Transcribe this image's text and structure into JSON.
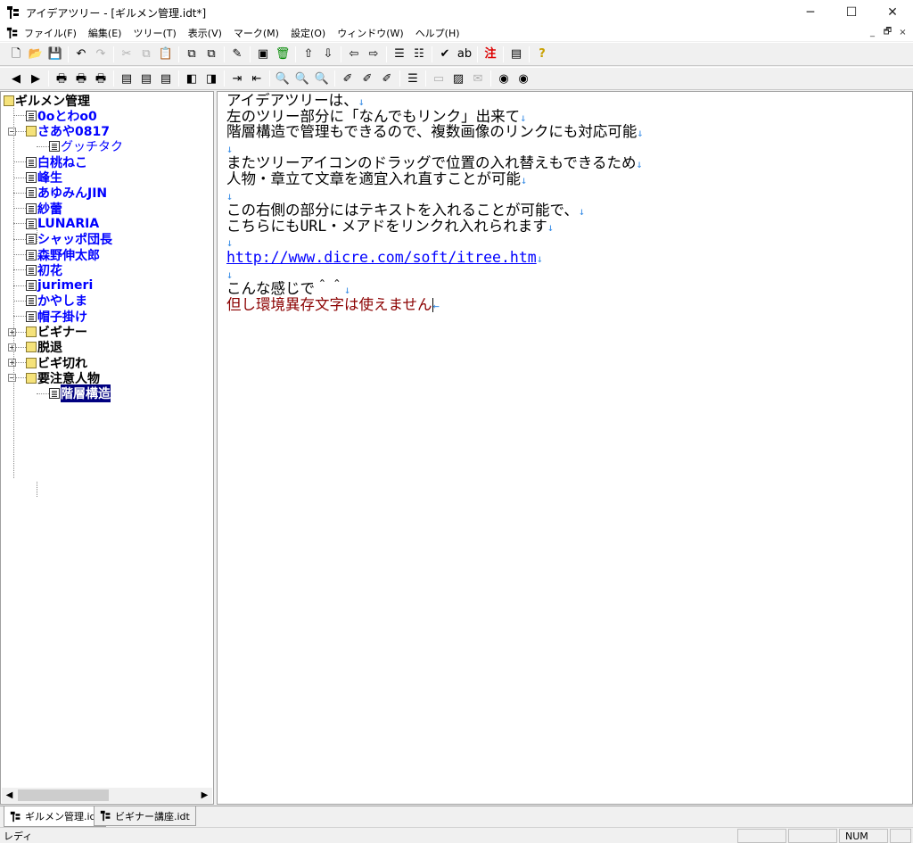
{
  "window": {
    "title": "アイデアツリー - [ギルメン管理.idt*]",
    "minimize": "─",
    "maximize": "☐",
    "close": "✕"
  },
  "menu": {
    "items": [
      "ファイル(F)",
      "編集(E)",
      "ツリー(T)",
      "表示(V)",
      "マーク(M)",
      "設定(O)",
      "ウィンドウ(W)",
      "ヘルプ(H)"
    ],
    "mdi_min": "_",
    "mdi_restore": "🗗",
    "mdi_close": "×"
  },
  "toolbar1": [
    {
      "icon": "new-file-icon",
      "glyph": "🗋"
    },
    {
      "icon": "open-folder-icon",
      "glyph": "📂"
    },
    {
      "icon": "save-icon",
      "glyph": "💾"
    },
    {
      "sep": true
    },
    {
      "icon": "undo-icon",
      "glyph": "↶"
    },
    {
      "icon": "redo-icon",
      "glyph": "↷",
      "disabled": true
    },
    {
      "sep": true
    },
    {
      "icon": "cut-icon",
      "glyph": "✂",
      "disabled": true
    },
    {
      "icon": "copy-icon",
      "glyph": "⧉",
      "disabled": true
    },
    {
      "icon": "paste-icon",
      "glyph": "📋"
    },
    {
      "sep": true
    },
    {
      "icon": "copy-node-icon",
      "glyph": "⧉"
    },
    {
      "icon": "paste-node-icon",
      "glyph": "⧉"
    },
    {
      "sep": true
    },
    {
      "icon": "edit-node-icon",
      "glyph": "✎"
    },
    {
      "sep": true
    },
    {
      "icon": "insert-node-icon",
      "glyph": "▣"
    },
    {
      "icon": "delete-node-icon",
      "glyph": "🗑"
    },
    {
      "sep": true
    },
    {
      "icon": "move-up-icon",
      "glyph": "⇧"
    },
    {
      "icon": "move-down-icon",
      "glyph": "⇩"
    },
    {
      "sep": true
    },
    {
      "icon": "move-left-icon",
      "glyph": "⇦"
    },
    {
      "icon": "move-right-icon",
      "glyph": "⇨"
    },
    {
      "sep": true
    },
    {
      "icon": "tree-level-icon",
      "glyph": "☰"
    },
    {
      "icon": "tree-expand-icon",
      "glyph": "☷"
    },
    {
      "sep": true
    },
    {
      "icon": "check-icon",
      "glyph": "✔"
    },
    {
      "icon": "strikethrough-icon",
      "glyph": "ab"
    },
    {
      "sep": true
    },
    {
      "icon": "note-mark-icon",
      "glyph": "注"
    },
    {
      "sep": true
    },
    {
      "icon": "window-icon",
      "glyph": "▤"
    },
    {
      "sep": true
    },
    {
      "icon": "help-icon",
      "glyph": "?"
    }
  ],
  "toolbar2": [
    {
      "icon": "back-icon",
      "glyph": "◀"
    },
    {
      "icon": "forward-icon",
      "glyph": "▶"
    },
    {
      "sep": true
    },
    {
      "icon": "print-icon",
      "glyph": "🖶"
    },
    {
      "icon": "print-preview-icon",
      "glyph": "🖶"
    },
    {
      "icon": "print-setup-icon",
      "glyph": "🖶"
    },
    {
      "sep": true
    },
    {
      "icon": "view-tree-icon",
      "glyph": "▤"
    },
    {
      "icon": "view-text-icon",
      "glyph": "▤"
    },
    {
      "icon": "view-split-icon",
      "glyph": "▤"
    },
    {
      "sep": true
    },
    {
      "icon": "layout-horizontal-icon",
      "glyph": "◧"
    },
    {
      "icon": "layout-vertical-icon",
      "glyph": "◨"
    },
    {
      "sep": true
    },
    {
      "icon": "import-icon",
      "glyph": "⇥"
    },
    {
      "icon": "export-icon",
      "glyph": "⇤"
    },
    {
      "sep": true
    },
    {
      "icon": "search-icon",
      "glyph": "🔍"
    },
    {
      "icon": "search-next-icon",
      "glyph": "🔍",
      "disabled": true
    },
    {
      "icon": "search-prev-icon",
      "glyph": "🔍",
      "disabled": true
    },
    {
      "sep": true
    },
    {
      "icon": "marker-a-icon",
      "glyph": "✐"
    },
    {
      "icon": "marker-b-icon",
      "glyph": "✐"
    },
    {
      "icon": "marker-c-icon",
      "glyph": "✐"
    },
    {
      "sep": true
    },
    {
      "icon": "tree-list-icon",
      "glyph": "☰"
    },
    {
      "sep": true
    },
    {
      "icon": "camera-icon",
      "glyph": "▭",
      "disabled": true
    },
    {
      "icon": "image-icon",
      "glyph": "▨"
    },
    {
      "icon": "mail-icon",
      "glyph": "✉",
      "disabled": true
    },
    {
      "sep": true
    },
    {
      "icon": "globe-icon",
      "glyph": "◉"
    },
    {
      "icon": "web-link-icon",
      "glyph": "◉"
    }
  ],
  "tree": {
    "nodes": [
      {
        "label": "ギルメン管理",
        "kind": "root-folder",
        "color": "black"
      },
      {
        "label": "0oとわo0",
        "kind": "doc"
      },
      {
        "label": "さあや0817",
        "kind": "folder",
        "expander": "−"
      },
      {
        "label": "グッチタク",
        "kind": "doc",
        "indent": 2,
        "plain": true
      },
      {
        "label": "白桃ねこ",
        "kind": "doc"
      },
      {
        "label": "峰生",
        "kind": "doc"
      },
      {
        "label": "あゆみんJIN",
        "kind": "doc"
      },
      {
        "label": "紗蕾",
        "kind": "doc"
      },
      {
        "label": "LUNARIA",
        "kind": "doc"
      },
      {
        "label": "シャッポ団長",
        "kind": "doc"
      },
      {
        "label": "森野伸太郎",
        "kind": "doc"
      },
      {
        "label": "初花",
        "kind": "doc"
      },
      {
        "label": "jurimeri",
        "kind": "doc"
      },
      {
        "label": "かやしま",
        "kind": "doc"
      },
      {
        "label": "帽子掛け",
        "kind": "doc"
      },
      {
        "label": "ビギナー",
        "kind": "folder",
        "color": "black",
        "expander": "+"
      },
      {
        "label": "脱退",
        "kind": "folder",
        "color": "black",
        "expander": "+"
      },
      {
        "label": "ビギ切れ",
        "kind": "folder",
        "color": "black",
        "expander": "+"
      },
      {
        "label": "要注意人物",
        "kind": "folder",
        "color": "black",
        "expander": "−"
      },
      {
        "label": "階層構造",
        "kind": "doc",
        "indent": 2,
        "selected": true
      }
    ]
  },
  "editor": {
    "lines": [
      {
        "text": "アイデアツリーは、",
        "ret": "↓"
      },
      {
        "text": "左のツリー部分に「なんでもリンク」出来て",
        "ret": "↓"
      },
      {
        "text": "階層構造で管理もできるので、複数画像のリンクにも対応可能",
        "ret": "↓"
      },
      {
        "text": "",
        "ret": "↓"
      },
      {
        "text": "またツリーアイコンのドラッグで位置の入れ替えもできるため",
        "ret": "↓"
      },
      {
        "text": "人物・章立て文章を適宜入れ直すことが可能",
        "ret": "↓"
      },
      {
        "text": "",
        "ret": "↓"
      },
      {
        "text": "この右側の部分にはテキストを入れることが可能で、",
        "ret": "↓"
      },
      {
        "text": "こちらにもURL・メアドをリンクれ入れられます",
        "ret": "↓"
      },
      {
        "text": "",
        "ret": "↓"
      },
      {
        "text": "http://www.dicre.com/soft/itree.htm",
        "ret": "↓",
        "link": true
      },
      {
        "text": "",
        "ret": "↓"
      },
      {
        "text": "こんな感じで＾＾",
        "ret": "↓"
      },
      {
        "text": "但し環境異存文字は使えません",
        "ret": "←",
        "red": true,
        "caret": true
      }
    ]
  },
  "tabs": [
    {
      "label": "ギルメン管理.idt",
      "active": true
    },
    {
      "label": "ビギナー講座.idt",
      "active": false
    }
  ],
  "status": {
    "text": "レディ",
    "num": "NUM"
  },
  "colors": {
    "node_blue": "#0000ff",
    "selected_bg": "#000080",
    "return_mark": "#3a8ee6",
    "red_text": "#8b0000"
  }
}
